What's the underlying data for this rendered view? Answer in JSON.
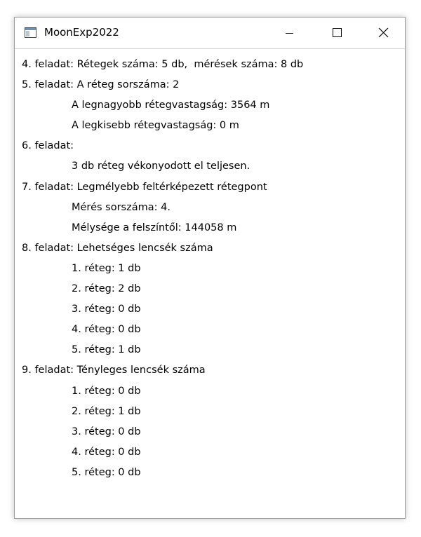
{
  "window": {
    "title": "MoonExp2022",
    "icon": "window-app-icon"
  },
  "caption_buttons": {
    "minimize_icon": "minimize-icon",
    "maximize_icon": "maximize-icon",
    "close_icon": "close-icon"
  },
  "output_lines": [
    "4. feladat: Rétegek száma: 5 db,  mérések száma: 8 db",
    "5. feladat: A réteg sorszáma: 2",
    "A legnagyobb rétegvastagság: 3564 m",
    "A legkisebb rétegvastagság: 0 m",
    "6. feladat:",
    "3 db réteg vékonyodott el teljesen.",
    "7. feladat: Legmélyebb feltérképezett rétegpont",
    "Mérés sorszáma: 4.",
    "Mélysége a felszíntől: 144058 m",
    "8. feladat: Lehetséges lencsék száma",
    "1. réteg: 1 db",
    "2. réteg: 2 db",
    "3. réteg: 0 db",
    "4. réteg: 0 db",
    "5. réteg: 1 db",
    "9. feladat: Tényleges lencsék száma",
    "1. réteg: 0 db",
    "2. réteg: 1 db",
    "3. réteg: 0 db",
    "4. réteg: 0 db",
    "5. réteg: 0 db"
  ]
}
